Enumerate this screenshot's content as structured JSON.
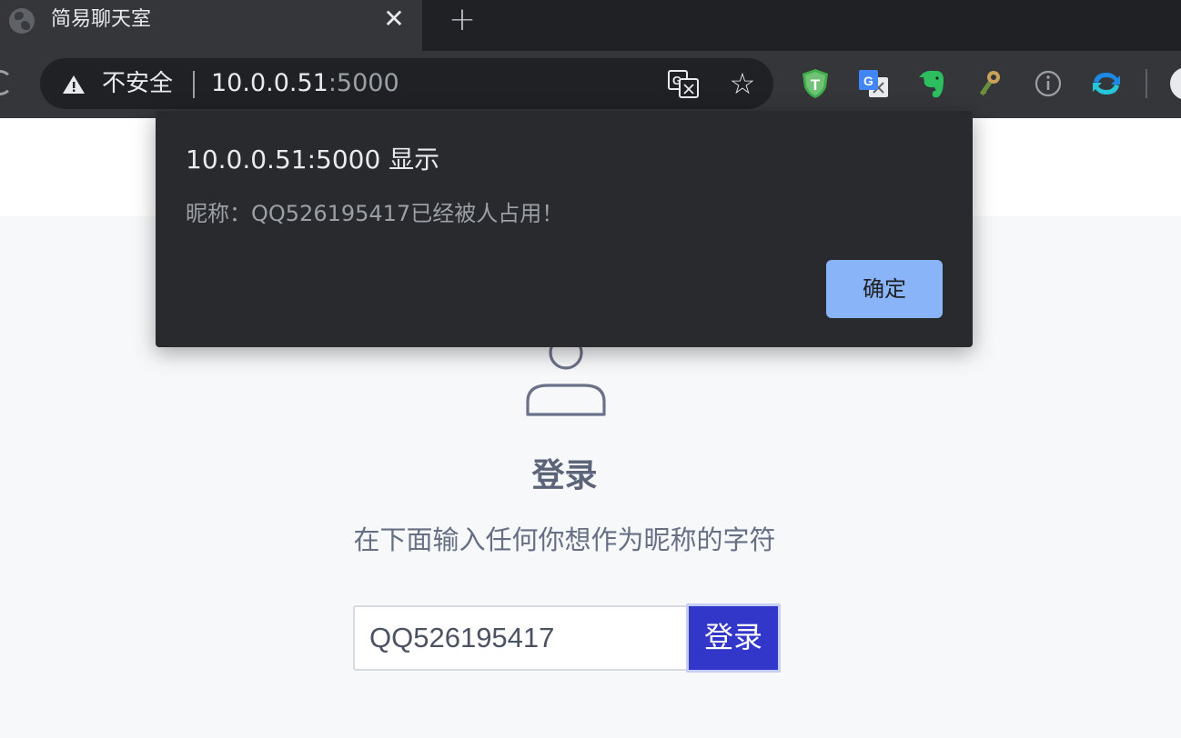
{
  "browser": {
    "tab": {
      "title": "简易聊天室",
      "close_glyph": "✕"
    },
    "new_tab_glyph": "+",
    "omnibox": {
      "security_label": "不安全",
      "url_host": "10.0.0.51",
      "url_port": ":5000"
    },
    "star_glyph": "☆",
    "extensions": [
      "shield-t-extension",
      "google-translate-extension",
      "evernote-extension",
      "key-extension",
      "info-extension",
      "sync-extension"
    ]
  },
  "dialog": {
    "title": "10.0.0.51:5000 显示",
    "message": "昵称：QQ526195417已经被人占用！",
    "ok_label": "确定",
    "ok_color": "#8ab4f8"
  },
  "login": {
    "heading": "登录",
    "subtitle": "在下面输入任何你想作为昵称的字符",
    "nickname_value": "QQ526195417",
    "button_label": "登录",
    "button_color": "#3337c9"
  }
}
